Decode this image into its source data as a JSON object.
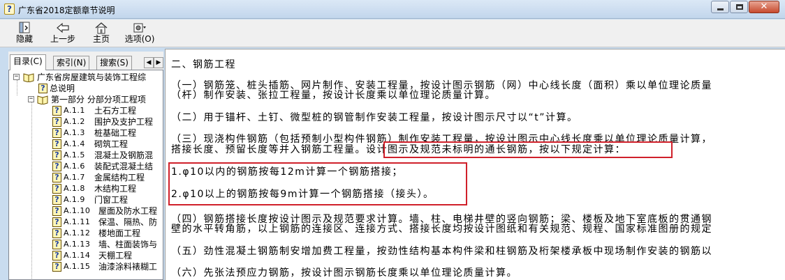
{
  "window": {
    "title": "广东省2018定额章节说明",
    "icon_name": "help-book-icon"
  },
  "toolbar": {
    "buttons": [
      {
        "label": "隐藏",
        "icon": "hide-icon"
      },
      {
        "label": "上一步",
        "icon": "back-arrow-icon"
      },
      {
        "label": "主页",
        "icon": "home-icon"
      },
      {
        "label": "选项(O)",
        "icon": "options-icon"
      }
    ]
  },
  "nav": {
    "tabs": [
      {
        "label": "目录(C)"
      },
      {
        "label": "索引(N)"
      },
      {
        "label": "搜索(S)"
      }
    ],
    "tree": {
      "root": {
        "label": "广东省房屋建筑与装饰工程综",
        "toggle": "−"
      },
      "overview": {
        "label": "总说明"
      },
      "part": {
        "label": "第一部分 分部分项工程项",
        "toggle": "−"
      },
      "items": [
        {
          "code": "A.1.1",
          "label": "土石方工程"
        },
        {
          "code": "A.1.2",
          "label": "围护及支护工程"
        },
        {
          "code": "A.1.3",
          "label": "桩基础工程"
        },
        {
          "code": "A.1.4",
          "label": "砌筑工程"
        },
        {
          "code": "A.1.5",
          "label": "混凝土及钢筋混"
        },
        {
          "code": "A.1.6",
          "label": "装配式混凝土结"
        },
        {
          "code": "A.1.7",
          "label": "金属结构工程"
        },
        {
          "code": "A.1.8",
          "label": "木结构工程"
        },
        {
          "code": "A.1.9",
          "label": "门窗工程"
        },
        {
          "code": "A.1.10",
          "label": "屋面及防水工程"
        },
        {
          "code": "A.1.11",
          "label": "保温、隔热、防"
        },
        {
          "code": "A.1.12",
          "label": "楼地面工程"
        },
        {
          "code": "A.1.13",
          "label": "墙、柱面装饰与"
        },
        {
          "code": "A.1.14",
          "label": "天棚工程"
        },
        {
          "code": "A.1.15",
          "label": "油漆涂料裱糊工"
        }
      ]
    }
  },
  "content": {
    "heading": "二、钢筋工程",
    "p1a": "（一）钢筋笼、桩头插筋、网片制作、安装工程量，按设计图示钢筋（网）中心线长度（面积）乘以单位理论质量",
    "p1b": "（杆）制作安装、张拉工程量，按设计长度乘以单位理论质量计算。",
    "p2": "（二）用于锚杆、土钉、微型桩的钢管制作安装工程量，按设计图示尺寸以“t”计算。",
    "p3a": "（三）现浇构件钢筋（包括预制小型构件钢筋）制作安装工程量，按设计图示中心线长度乘以单位理论质量计算，",
    "p3b_prefix": "搭接长度、预留长度等并入钢筋工程量。",
    "p3b_highlight": "设计图示及规范未标明的通长钢筋，按以下规定计算：",
    "rule1": "1.φ10以内的钢筋按每12m计算一个钢筋搭接；",
    "rule2": "2.φ10以上的钢筋按每9m计算一个钢筋搭接（接头）。",
    "p4a": "（四）钢筋搭接长度按设计图示及规范要求计算。墙、柱、电梯井壁的竖向钢筋；梁、楼板及地下室底板的贯通钢",
    "p4b": "壁的水平转角筋，以上钢筋的连接区、连接方式、搭接长度均按设计图纸和有关规范、规程、国家标准图册的规定",
    "p5": "（五）劲性混凝土钢筋制安增加费工程量，按劲性结构基本构件梁和柱钢筋及桁架楼承板中现场制作安装的钢筋以",
    "p6": "（六）先张法预应力钢筋，按设计图示钢筋长度乘以单位理论质量计算。"
  },
  "highlight_color": "#d0202a"
}
